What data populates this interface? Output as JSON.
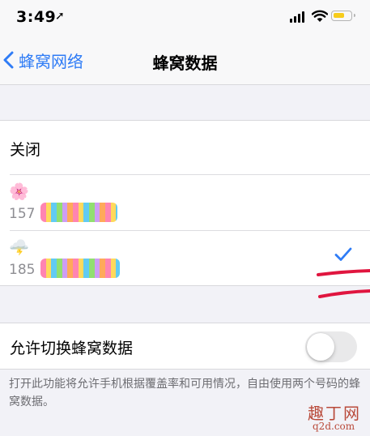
{
  "status_bar": {
    "time": "3:49",
    "location_arrow": "➚"
  },
  "nav": {
    "back_label": "蜂窝网络",
    "title": "蜂窝数据"
  },
  "cellular_data_options": {
    "off_label": "关闭",
    "sims": [
      {
        "emoji": "🌸",
        "number_prefix": "157",
        "selected": false
      },
      {
        "emoji": "🌩️",
        "number_prefix": "185",
        "selected": true
      }
    ]
  },
  "switching": {
    "label": "允许切换蜂窝数据",
    "enabled": false,
    "footer": "打开此功能将允许手机根据覆盖率和可用情况，自由使用两个号码的蜂窝数据。"
  },
  "watermark": {
    "line1": "趣丁网",
    "line2": "q2d.com"
  },
  "colors": {
    "accent": "#2f7cf6",
    "background": "#f2f2f7",
    "annotation_red": "#e0153f",
    "battery": "#f7cc1c"
  },
  "icons": [
    "location-arrow-icon",
    "signal-icon",
    "wifi-icon",
    "battery-icon",
    "chevron-left-icon",
    "checkmark-icon"
  ]
}
